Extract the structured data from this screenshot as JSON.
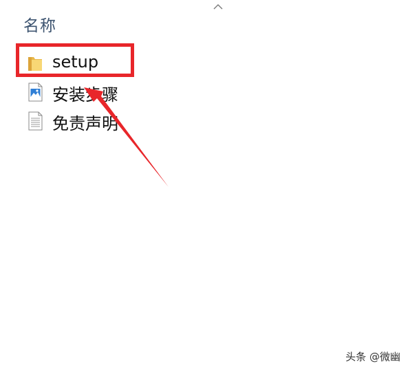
{
  "header": {
    "column_name": "名称"
  },
  "files": [
    {
      "name": "setup",
      "icon": "folder-icon",
      "selected": true
    },
    {
      "name": "安装步骤",
      "icon": "image-file-icon",
      "selected": false
    },
    {
      "name": "免责声明",
      "icon": "text-file-icon",
      "selected": false
    }
  ],
  "annotation": {
    "highlight_color": "#e8262a"
  },
  "watermark": {
    "text": "头条 @微幽"
  }
}
